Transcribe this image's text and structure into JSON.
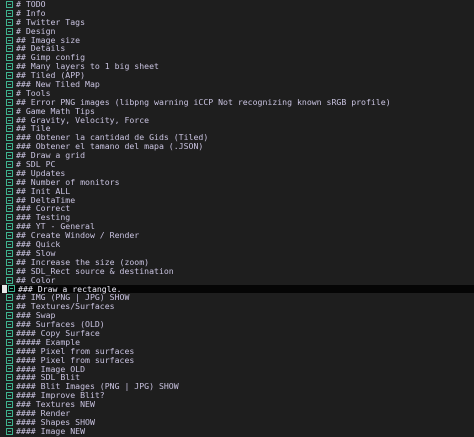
{
  "colors": {
    "background": "#1e1e1e",
    "text": "#c9c3e0",
    "icon": "#3fb38f",
    "highlight_row": "#050505"
  },
  "outline": {
    "icon_name": "collapse-toggle-icon",
    "highlighted_index": 32,
    "items": [
      "# TODO",
      "# Info",
      "# Twitter Tags",
      "# Design",
      "## Image size",
      "## Details",
      "## Gimp config",
      "## Many layers to 1 big sheet",
      "## Tiled (APP)",
      "### New Tiled Map",
      "# Tools",
      "## Error PNG images (libpng warning iCCP Not recognizing known sRGB profile)",
      "# Game Math Tips",
      "## Gravity, Velocity, Force",
      "## Tile",
      "### Obtener la cantidad de Gids (Tiled)",
      "### Obtener el tamano del mapa (.JSON)",
      "## Draw a grid",
      "# SDL PC",
      "## Updates",
      "## Number of monitors",
      "## Init ALL",
      "## DeltaTime",
      "### Correct",
      "### Testing",
      "### YT - General",
      "## Create Window / Render",
      "### Quick",
      "### Slow",
      "## Increase the size (zoom)",
      "## SDL_Rect source & destination",
      "## Color",
      "### Draw a rectangle.",
      "## IMG (PNG | JPG) SHOW",
      "## Textures/Surfaces",
      "### Swap",
      "### Surfaces (OLD)",
      "#### Copy Surface",
      "##### Example",
      "#### Pixel from surfaces",
      "#### Pixel from surfaces",
      "#### Image OLD",
      "#### SDL Blit",
      "#### Blit Images (PNG | JPG) SHOW",
      "#### Improve Blit?",
      "### Textures NEW",
      "#### Render",
      "#### Shapes SHOW",
      "#### Image NEW"
    ]
  }
}
